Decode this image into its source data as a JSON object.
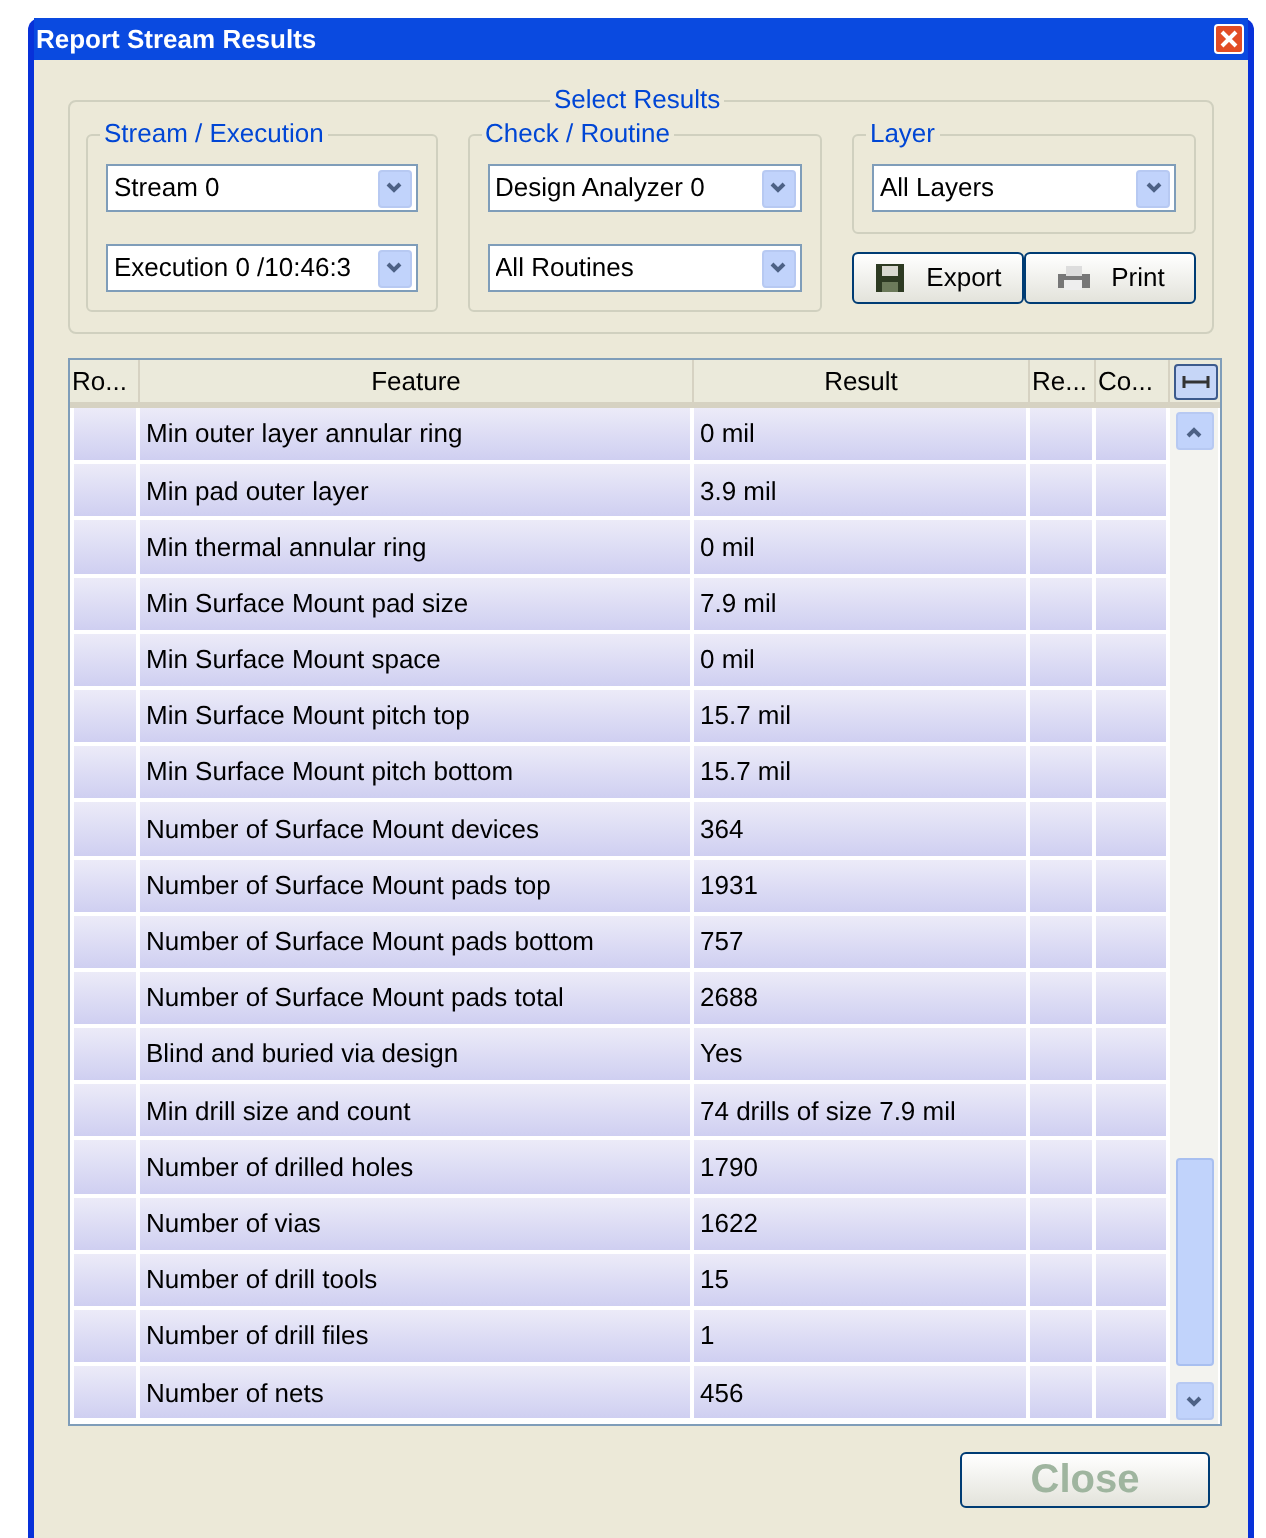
{
  "window": {
    "title": "Report Stream Results"
  },
  "select_results": {
    "title": "Select Results",
    "groups": [
      {
        "title": "Stream / Execution",
        "dropdowns": [
          "Stream 0",
          "Execution 0 /10:46:3"
        ]
      },
      {
        "title": "Check / Routine",
        "dropdowns": [
          "Design Analyzer 0",
          "All Routines"
        ]
      },
      {
        "title": "Layer",
        "dropdowns": [
          "All Layers"
        ]
      }
    ]
  },
  "buttons": [
    {
      "kind": "export",
      "label": "Export"
    },
    {
      "kind": "print",
      "label": "Print"
    }
  ],
  "table": {
    "columns": [
      "Ro...",
      "Feature",
      "Result",
      "Re...",
      "Co..."
    ],
    "rows": [
      [
        "Min outer layer annular ring",
        "0 mil"
      ],
      [
        "Min pad outer layer",
        "3.9 mil"
      ],
      [
        "Min thermal annular ring",
        "0 mil"
      ],
      [
        "Min Surface Mount pad size",
        "7.9 mil"
      ],
      [
        "Min Surface Mount space",
        "0 mil"
      ],
      [
        "Min Surface Mount pitch top",
        "15.7 mil"
      ],
      [
        "Min Surface Mount pitch bottom",
        "15.7 mil"
      ],
      [
        "Number of Surface Mount devices",
        "364"
      ],
      [
        "Number of Surface Mount pads top",
        "1931"
      ],
      [
        "Number of Surface Mount pads bottom",
        "757"
      ],
      [
        "Number of Surface Mount pads total",
        "2688"
      ],
      [
        "Blind and buried via design",
        "Yes"
      ],
      [
        "Min drill size and count",
        "74 drills of size 7.9 mil"
      ],
      [
        "Number of drilled holes",
        "1790"
      ],
      [
        "Number of vias",
        "1622"
      ],
      [
        "Number of drill tools",
        "15"
      ],
      [
        "Number of drill files",
        "1"
      ],
      [
        "Number of nets",
        "456"
      ]
    ]
  },
  "close_button": "Close"
}
